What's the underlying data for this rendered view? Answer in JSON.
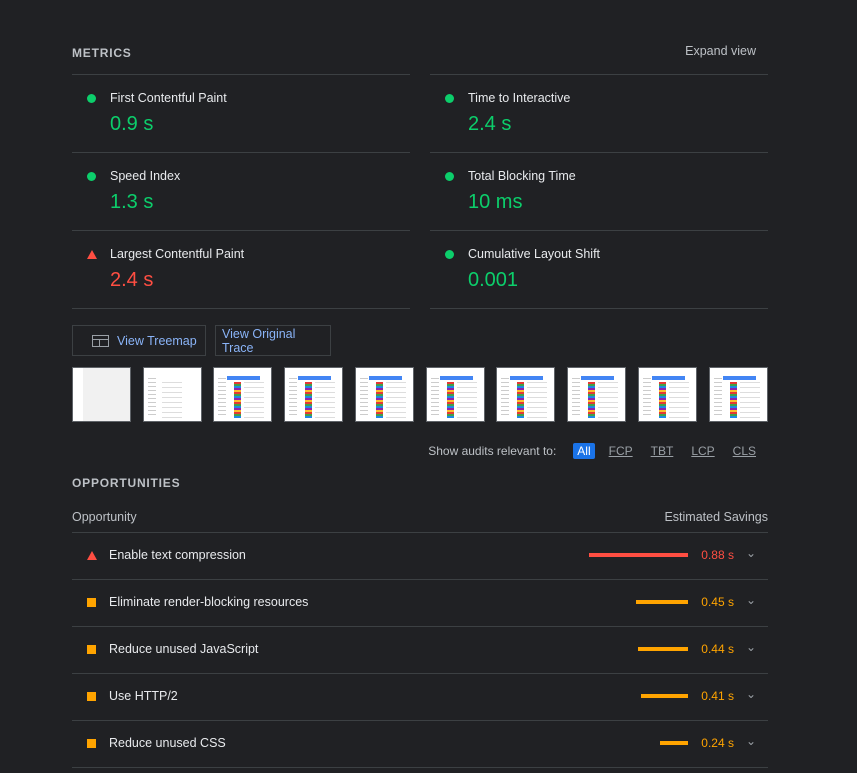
{
  "metrics_section": {
    "title": "METRICS",
    "expand_label": "Expand view",
    "items": [
      {
        "label": "First Contentful Paint",
        "value": "0.9 s",
        "status": "pass"
      },
      {
        "label": "Time to Interactive",
        "value": "2.4 s",
        "status": "pass"
      },
      {
        "label": "Speed Index",
        "value": "1.3 s",
        "status": "pass"
      },
      {
        "label": "Total Blocking Time",
        "value": "10 ms",
        "status": "pass"
      },
      {
        "label": "Largest Contentful Paint",
        "value": "2.4 s",
        "status": "fail"
      },
      {
        "label": "Cumulative Layout Shift",
        "value": "0.001",
        "status": "pass"
      }
    ]
  },
  "buttons": {
    "treemap": "View Treemap",
    "trace": "View Original Trace"
  },
  "filmstrip_frame_count": 10,
  "filter": {
    "label": "Show audits relevant to:",
    "options": [
      "All",
      "FCP",
      "TBT",
      "LCP",
      "CLS"
    ],
    "selected": "All"
  },
  "opportunities": {
    "title": "OPPORTUNITIES",
    "col_left": "Opportunity",
    "col_right": "Estimated Savings",
    "items": [
      {
        "label": "Enable text compression",
        "savings": "0.88 s",
        "severity": "fail",
        "savings_seconds": 0.88
      },
      {
        "label": "Eliminate render-blocking resources",
        "savings": "0.45 s",
        "severity": "average",
        "savings_seconds": 0.45
      },
      {
        "label": "Reduce unused JavaScript",
        "savings": "0.44 s",
        "severity": "average",
        "savings_seconds": 0.44
      },
      {
        "label": "Use HTTP/2",
        "savings": "0.41 s",
        "severity": "average",
        "savings_seconds": 0.41
      },
      {
        "label": "Reduce unused CSS",
        "savings": "0.24 s",
        "severity": "average",
        "savings_seconds": 0.24
      }
    ]
  },
  "colors": {
    "pass": "#0cce6b",
    "average": "#ffa400",
    "fail": "#ff4e42",
    "link": "#8ab4f8"
  }
}
